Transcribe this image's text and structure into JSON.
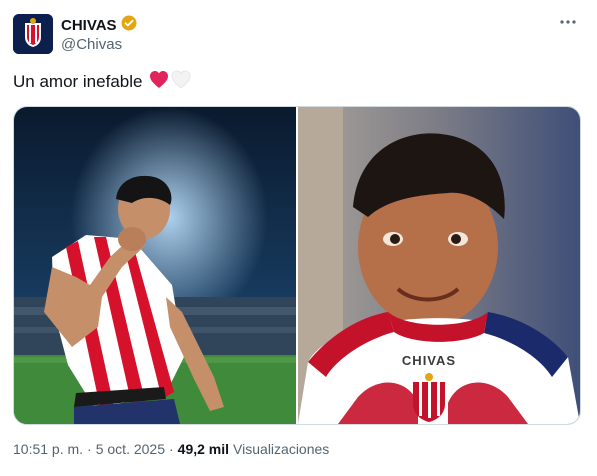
{
  "author": {
    "name": "CHIVAS",
    "handle": "@Chivas",
    "verified_badge_color": "#e2a612"
  },
  "tweet": {
    "text": "Un amor inefable",
    "emojis": [
      "red-heart",
      "white-heart"
    ]
  },
  "media": {
    "left_image": "player-in-red-white-jersey-stadium",
    "right_image": "child-in-chivas-shirt",
    "shirt_text": "CHIVAS"
  },
  "footer": {
    "time": "10:51 p. m.",
    "sep1": "·",
    "date": "5 oct. 2025",
    "sep2": "·",
    "views_count": "49,2 mil",
    "views_label": "Visualizaciones"
  },
  "colors": {
    "text": "#0f1419",
    "secondary": "#536471",
    "red_heart": "#e0245e",
    "chivas_red": "#d6112b",
    "chivas_blue": "#1b2a6b"
  }
}
